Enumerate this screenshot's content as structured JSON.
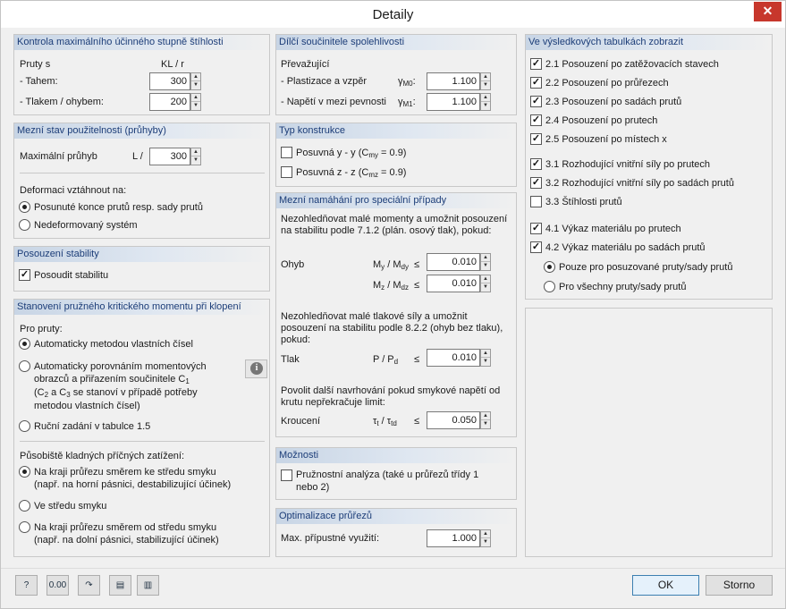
{
  "window": {
    "title": "Detaily",
    "close_icon": "close-icon"
  },
  "slenderness": {
    "header": "Kontrola maximálního účinného stupně štíhlosti",
    "col1": "Pruty s",
    "col2": "KL / r",
    "tension_label": "- Tahem:",
    "tension_value": "300",
    "compression_label": "- Tlakem / ohybem:",
    "compression_value": "200"
  },
  "serviceability": {
    "header": "Mezní stav použitelnosti (průhyby)",
    "max_label": "Maximální průhyb",
    "l_label": "L /",
    "max_value": "300",
    "relate_label": "Deformaci vztáhnout na:",
    "opt1": "Posunuté konce prutů resp. sady prutů",
    "opt2": "Nedeformovaný systém"
  },
  "stability": {
    "header": "Posouzení stability",
    "check": "Posoudit stabilitu"
  },
  "ltb": {
    "header": "Stanovení pružného kritického momentu při klopení",
    "for_members": "Pro pruty:",
    "opt1": "Automaticky metodou vlastních čísel",
    "opt2_line1": "Automaticky porovnáním momentových",
    "opt2_line2": "obrazců a přiřazením součinitele C",
    "opt2_line2_sub": "1",
    "opt2_line3": "(C",
    "opt2_line3_sub1": "2",
    "opt2_line3_mid": " a C",
    "opt2_line3_sub2": "3",
    "opt2_line3_end": " se stanoví v případě potřeby",
    "opt2_line4": "metodou vlastních čísel)",
    "opt3": "Ruční zadání v tabulce 1.5",
    "load_label": "Působiště kladných příčných zatížení:",
    "load1_line1": "Na kraji průřezu směrem ke středu smyku",
    "load1_line2": "(např. na horní pásnici, destabilizující účinek)",
    "load2": "Ve středu smyku",
    "load3_line1": "Na kraji průřezu  směrem od středu smyku",
    "load3_line2": "(např. na dolní pásnici, stabilizující účinek)"
  },
  "partial": {
    "header": "Dílčí součinitele spolehlivosti",
    "predominant": "Převažující",
    "plast_label": "- Plastizace a vzpěr",
    "g0_sym": "γ",
    "g0_sub": "M0",
    "g0_colon": ":",
    "g0_value": "1.100",
    "stress_label": "- Napětí v mezi pevnosti",
    "g1_sym": "γ",
    "g1_sub": "M1",
    "g1_colon": ":",
    "g1_value": "1.100"
  },
  "construction": {
    "header": "Typ konstrukce",
    "opt1": "Posuvná y - y (C",
    "opt1_sub": "my",
    "opt1_end": " = 0.9)",
    "opt2": "Posuvná z - z (C",
    "opt2_sub": "mz",
    "opt2_end": " = 0.9)"
  },
  "special": {
    "header": "Mezní namáhání pro speciální případy",
    "desc1": "Nezohledňovat malé momenty a umožnit posouzení na stabilitu podle 7.1.2 (plán. osový tlak), pokud:",
    "bending_label": "Ohyb",
    "my_label": "M",
    "my_sub1": "y",
    "my_mid": " / M",
    "my_sub2": "dy",
    "my_le": "≤",
    "my_value": "0.010",
    "mz_label": "M",
    "mz_sub1": "z",
    "mz_mid": " / M",
    "mz_sub2": "dz",
    "mz_le": "≤",
    "mz_value": "0.010",
    "desc2": "Nezohledňovat malé tlakové síly a umožnit posouzení na stabilitu podle 8.2.2 (ohyb bez tlaku), pokud:",
    "comp_label": "Tlak",
    "p_label": "P / P",
    "p_sub": "d",
    "p_le": "≤",
    "p_value": "0.010",
    "desc3": "Povolit další navrhování pokud smykové napětí od krutu nepřekračuje limit:",
    "torsion_label": "Kroucení",
    "tau_label": "τ",
    "tau_sub1": "t",
    "tau_mid": " / τ",
    "tau_sub2": "td",
    "tau_le": "≤",
    "tau_value": "0.050"
  },
  "options": {
    "header": "Možnosti",
    "elastic_line1": "Pružnostní analýza (také u průřezů třídy 1",
    "elastic_line2": "nebo 2)"
  },
  "optimization": {
    "header": "Optimalizace průřezů",
    "max_label": "Max. přípustné využití:",
    "max_value": "1.000"
  },
  "results": {
    "header": "Ve výsledkových tabulkách zobrazit",
    "items": [
      {
        "label": "2.1 Posouzení po zatěžovacích stavech",
        "checked": "✓"
      },
      {
        "label": "2.2 Posouzení po průřezech",
        "checked": "✓"
      },
      {
        "label": "2.3 Posouzení po sadách prutů",
        "checked": "✓"
      },
      {
        "label": "2.4 Posouzení po prutech",
        "checked": "✓"
      },
      {
        "label": "2.5 Posouzení po místech x",
        "checked": "✓"
      },
      {
        "label": "3.1 Rozhodující vnitřní síly po prutech",
        "checked": "✓"
      },
      {
        "label": "3.2 Rozhodující vnitřní síly po sadách prutů",
        "checked": "✓"
      },
      {
        "label": "3.3 Štíhlosti prutů",
        "checked": ""
      },
      {
        "label": "4.1 Výkaz materiálu po prutech",
        "checked": "✓"
      },
      {
        "label": "4.2 Výkaz materiálu po sadách prutů",
        "checked": "✓"
      }
    ],
    "radio1": "Pouze pro posuzované pruty/sady prutů",
    "radio2": "Pro všechny pruty/sady prutů"
  },
  "footer": {
    "ok": "OK",
    "cancel": "Storno",
    "units_icon_text": "0.00"
  }
}
